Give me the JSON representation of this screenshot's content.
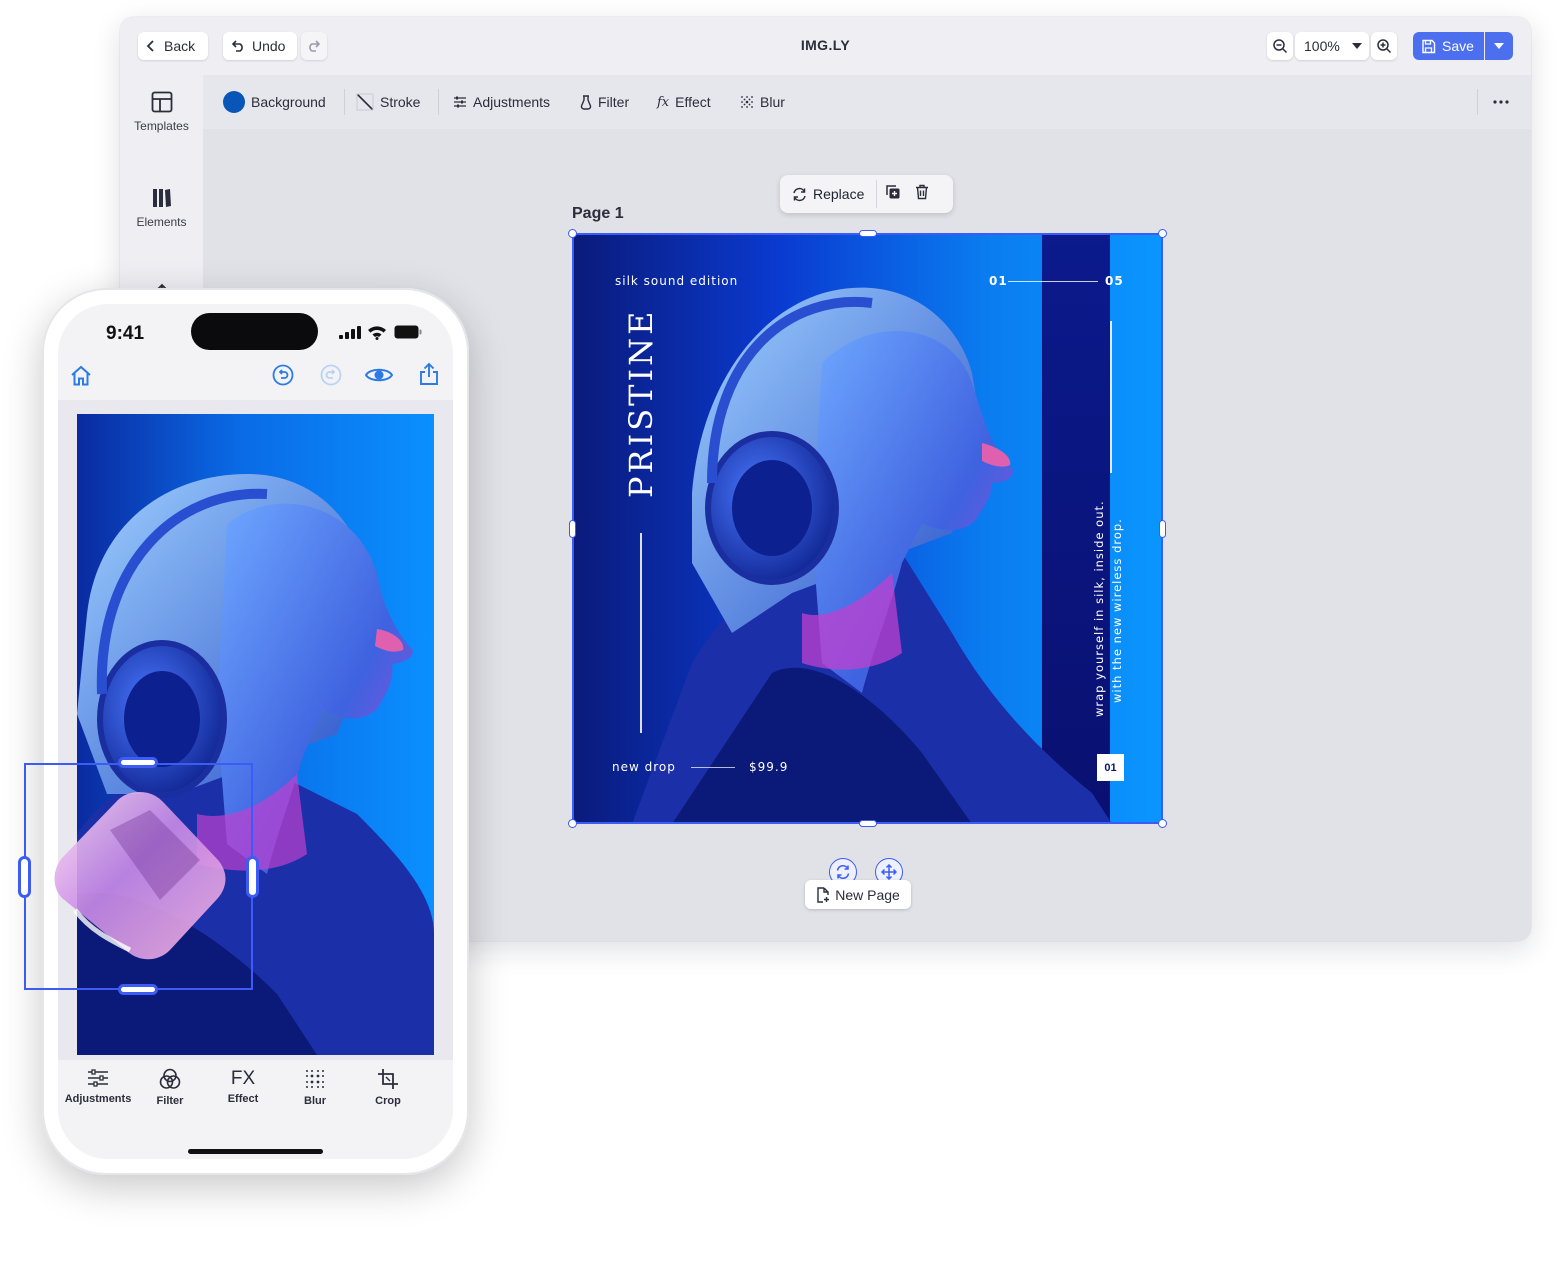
{
  "desktop": {
    "title": "IMG.LY",
    "back_label": "Back",
    "undo_label": "Undo",
    "zoom_value": "100%",
    "save_label": "Save",
    "sidebar": [
      {
        "label": "Templates",
        "icon": "templates-icon"
      },
      {
        "label": "Elements",
        "icon": "elements-icon"
      },
      {
        "label": "",
        "icon": "upload-icon"
      }
    ],
    "properties": [
      {
        "label": "Background",
        "icon": "color-swatch-icon"
      },
      {
        "label": "Stroke",
        "icon": "stroke-icon"
      },
      {
        "label": "Adjustments",
        "icon": "sliders-icon"
      },
      {
        "label": "Filter",
        "icon": "filter-icon"
      },
      {
        "label": "Effect",
        "icon": "fx-icon"
      },
      {
        "label": "Blur",
        "icon": "blur-icon"
      }
    ],
    "accent_color": "#3c5cf5",
    "page_label": "Page 1",
    "replace_label": "Replace",
    "new_page_label": "New Page",
    "poster": {
      "edition": "silk sound edition",
      "counter_start": "01",
      "counter_end": "05",
      "brand": "PRISTINE",
      "tagline_1": "wrap yourself in silk, inside out.",
      "tagline_2": "with the new wireless drop.",
      "drop_label": "new drop",
      "price": "$99.9",
      "page_badge": "01"
    }
  },
  "phone": {
    "time": "9:41",
    "tabs": [
      {
        "label": "Adjustments",
        "icon": "sliders-icon"
      },
      {
        "label": "Filter",
        "icon": "filter-icon"
      },
      {
        "label": "Effect",
        "icon": "fx-icon"
      },
      {
        "label": "Blur",
        "icon": "blur-icon"
      },
      {
        "label": "Crop",
        "icon": "crop-icon"
      }
    ],
    "fx_glyph": "FX"
  }
}
